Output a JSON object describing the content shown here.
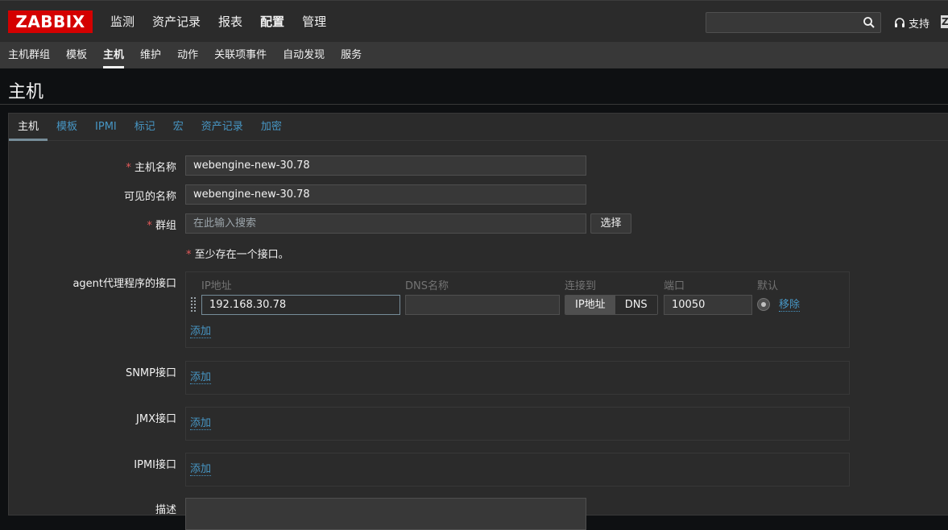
{
  "brand": "ZABBIX",
  "main_menu": [
    "监测",
    "资产记录",
    "报表",
    "配置",
    "管理"
  ],
  "search": {
    "value": ""
  },
  "support_label": "支持",
  "edge_label": "Z",
  "sub_menu": [
    "主机群组",
    "模板",
    "主机",
    "维护",
    "动作",
    "关联项事件",
    "自动发现",
    "服务"
  ],
  "page_title": "主机",
  "tabs": [
    "主机",
    "模板",
    "IPMI",
    "标记",
    "宏",
    "资产记录",
    "加密"
  ],
  "form": {
    "host_name_label": "主机名称",
    "host_name_value": "webengine-new-30.78",
    "visible_name_label": "可见的名称",
    "visible_name_value": "webengine-new-30.78",
    "groups_label": "群组",
    "groups_placeholder": "在此输入搜索",
    "select_button": "选择",
    "required_star": "*",
    "note": "至少存在一个接口。"
  },
  "agent": {
    "label": "agent代理程序的接口",
    "col_ip": "IP地址",
    "col_dns": "DNS名称",
    "col_connect": "连接到",
    "col_port": "端口",
    "col_default": "默认",
    "ip_value": "192.168.30.78",
    "dns_value": "",
    "connect_ip": "IP地址",
    "connect_dns": "DNS",
    "port_value": "10050",
    "remove_link": "移除",
    "add_link": "添加"
  },
  "snmp": {
    "label": "SNMP接口",
    "add_link": "添加"
  },
  "jmx": {
    "label": "JMX接口",
    "add_link": "添加"
  },
  "ipmi": {
    "label": "IPMI接口",
    "add_link": "添加"
  },
  "description_label": "描述",
  "colors": {
    "accent_link": "#4796c4",
    "required": "#e45959",
    "logo_bg": "#d40000"
  }
}
